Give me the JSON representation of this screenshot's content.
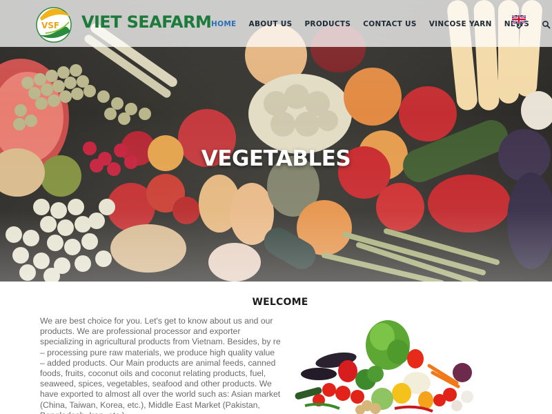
{
  "header": {
    "logo_text": "VSF",
    "brand": "VIET SEAFARM",
    "nav": [
      {
        "label": "HOME",
        "active": true
      },
      {
        "label": "ABOUT US",
        "active": false
      },
      {
        "label": "PRODUCTS",
        "active": false
      },
      {
        "label": "CONTACT US",
        "active": false
      },
      {
        "label": "VINCOSE YARN",
        "active": false
      },
      {
        "label": "NEWS",
        "active": false
      }
    ],
    "search_icon": "search-icon",
    "language_icon": "uk-flag-icon"
  },
  "hero": {
    "title": "VEGETABLES"
  },
  "welcome": {
    "title": "WELCOME",
    "text": "We are best choice for you. Let's get to know about us and our products. We are professional processor and exporter specializing in agricultural products from Vietnam. Besides, by re – processing pure raw materials, we produce high quality value – added products. Our Main products are animal feeds, canned foods, fruits, coconut oils and coconut relating products, fuel, seaweed, spices, vegetables, seafood and other products. We have exported to almost all over the world such as: Asian market (China, Taiwan, Korea, etc.), Middle East Market (Pakistan, Bangladesh, Iran, etc.)"
  },
  "colors": {
    "brand_green": "#1c7a3a",
    "nav_active": "#2b6fb5",
    "nav_text": "#1e2b36"
  }
}
